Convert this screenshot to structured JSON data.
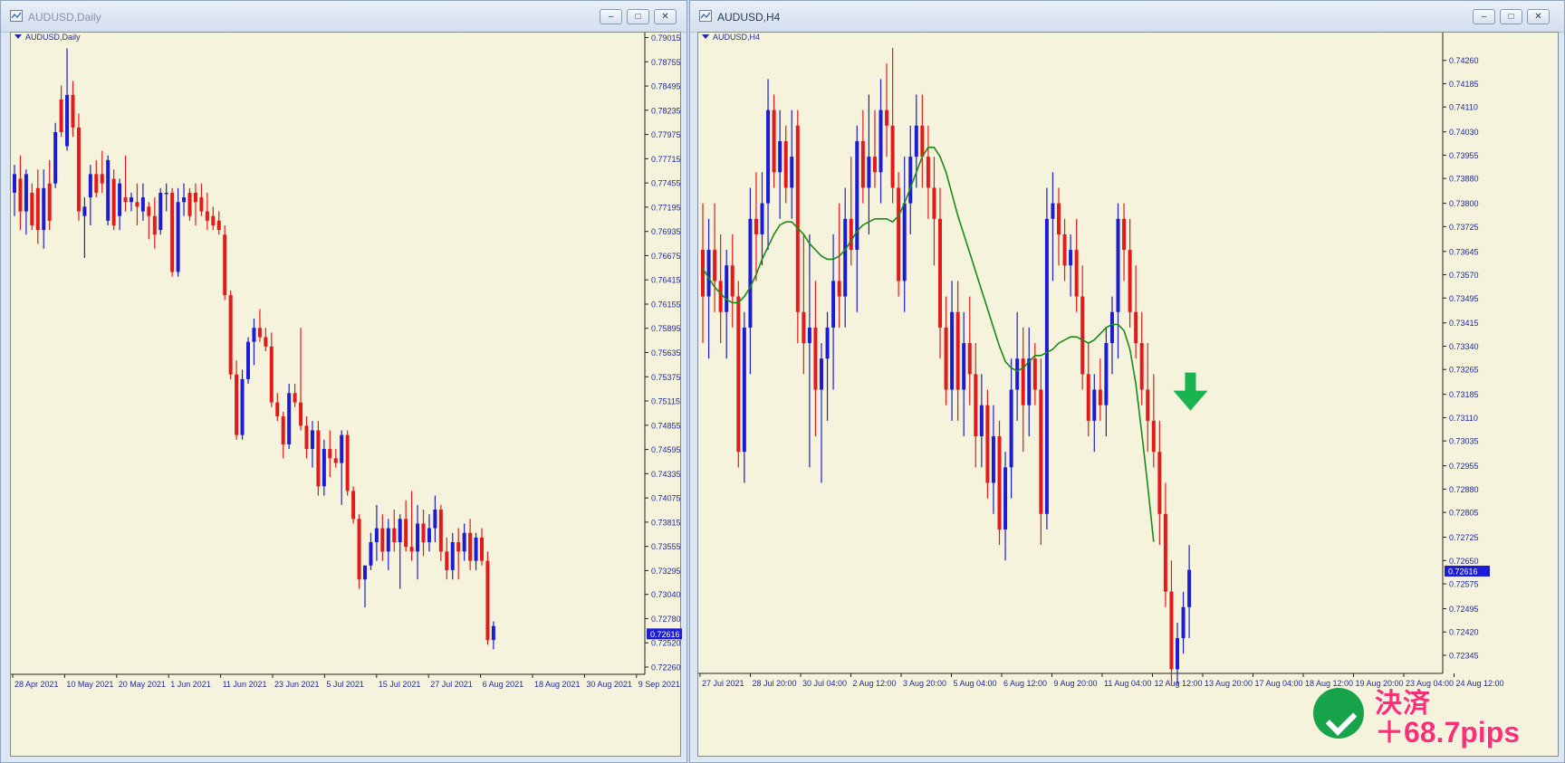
{
  "windows": {
    "left": {
      "title": "AUDUSD,Daily",
      "symbol_label": "AUDUSD,Daily"
    },
    "right": {
      "title": "AUDUSD,H4",
      "symbol_label": "AUDUSD,H4"
    }
  },
  "window_buttons": [
    "minimize",
    "restore",
    "close"
  ],
  "colors": {
    "background": "#f5f3dc",
    "bull": "#1c1cd6",
    "bear": "#e41a1a",
    "ma": "#1a8a1a",
    "price_tag": "#1c1cd6",
    "signal_arrow": "#19b44f",
    "badge": "#17a34a",
    "result_text": "#ff2f74"
  },
  "chart_data": [
    {
      "type": "candlestick",
      "title": "AUDUSD,Daily",
      "current_price": 0.72616,
      "y_ticks": [
        "0.79015",
        "0.78755",
        "0.78495",
        "0.78235",
        "0.77975",
        "0.77715",
        "0.77455",
        "0.77195",
        "0.76935",
        "0.76675",
        "0.76415",
        "0.76155",
        "0.75895",
        "0.75635",
        "0.75375",
        "0.75115",
        "0.74855",
        "0.74595",
        "0.74335",
        "0.74075",
        "0.73815",
        "0.73555",
        "0.73295",
        "0.73040",
        "0.72780",
        "0.72520",
        "0.72260"
      ],
      "x_ticks": [
        "28 Apr 2021",
        "10 May 2021",
        "20 May 2021",
        "1 Jun 2021",
        "11 Jun 2021",
        "23 Jun 2021",
        "5 Jul 2021",
        "15 Jul 2021",
        "27 Jul 2021",
        "6 Aug 2021",
        "18 Aug 2021",
        "30 Aug 2021",
        "9 Sep 2021"
      ],
      "ylim": [
        0.7226,
        0.7902
      ],
      "candles": [
        [
          0.7735,
          0.7765,
          0.771,
          0.7755
        ],
        [
          0.775,
          0.7775,
          0.7695,
          0.7715
        ],
        [
          0.7715,
          0.776,
          0.769,
          0.7755
        ],
        [
          0.7735,
          0.7745,
          0.7695,
          0.77
        ],
        [
          0.774,
          0.776,
          0.768,
          0.7695
        ],
        [
          0.7695,
          0.776,
          0.7675,
          0.774
        ],
        [
          0.7745,
          0.777,
          0.7695,
          0.7705
        ],
        [
          0.7745,
          0.781,
          0.774,
          0.78
        ],
        [
          0.7835,
          0.785,
          0.7795,
          0.78
        ],
        [
          0.7785,
          0.789,
          0.778,
          0.784
        ],
        [
          0.784,
          0.7855,
          0.7795,
          0.7805
        ],
        [
          0.7805,
          0.782,
          0.7705,
          0.7715
        ],
        [
          0.771,
          0.773,
          0.7665,
          0.772
        ],
        [
          0.773,
          0.7765,
          0.77,
          0.7755
        ],
        [
          0.7755,
          0.777,
          0.773,
          0.7735
        ],
        [
          0.7755,
          0.778,
          0.7735,
          0.7745
        ],
        [
          0.7705,
          0.7775,
          0.77,
          0.777
        ],
        [
          0.775,
          0.776,
          0.7695,
          0.77
        ],
        [
          0.771,
          0.775,
          0.7695,
          0.7745
        ],
        [
          0.773,
          0.7775,
          0.7715,
          0.7725
        ],
        [
          0.7725,
          0.7735,
          0.7715,
          0.773
        ],
        [
          0.7725,
          0.7745,
          0.77,
          0.772
        ],
        [
          0.7715,
          0.7745,
          0.7705,
          0.773
        ],
        [
          0.772,
          0.7725,
          0.7685,
          0.771
        ],
        [
          0.771,
          0.773,
          0.7675,
          0.769
        ],
        [
          0.7695,
          0.774,
          0.769,
          0.7735
        ],
        [
          0.7735,
          0.7745,
          0.7715,
          0.7735
        ],
        [
          0.7735,
          0.774,
          0.7645,
          0.765
        ],
        [
          0.765,
          0.774,
          0.7645,
          0.7725
        ],
        [
          0.7725,
          0.7745,
          0.771,
          0.773
        ],
        [
          0.7735,
          0.774,
          0.7705,
          0.771
        ],
        [
          0.7735,
          0.7745,
          0.77,
          0.7725
        ],
        [
          0.773,
          0.7745,
          0.771,
          0.7715
        ],
        [
          0.7715,
          0.7735,
          0.7695,
          0.7705
        ],
        [
          0.771,
          0.772,
          0.7695,
          0.77
        ],
        [
          0.7705,
          0.7715,
          0.769,
          0.7695
        ],
        [
          0.769,
          0.77,
          0.762,
          0.7625
        ],
        [
          0.7625,
          0.763,
          0.7535,
          0.754
        ],
        [
          0.754,
          0.7555,
          0.747,
          0.7475
        ],
        [
          0.7475,
          0.7545,
          0.747,
          0.7535
        ],
        [
          0.7535,
          0.758,
          0.753,
          0.7575
        ],
        [
          0.7575,
          0.76,
          0.755,
          0.759
        ],
        [
          0.759,
          0.761,
          0.7575,
          0.758
        ],
        [
          0.758,
          0.759,
          0.7565,
          0.757
        ],
        [
          0.757,
          0.7585,
          0.7505,
          0.751
        ],
        [
          0.751,
          0.752,
          0.749,
          0.7495
        ],
        [
          0.7495,
          0.75,
          0.745,
          0.7465
        ],
        [
          0.7465,
          0.753,
          0.746,
          0.752
        ],
        [
          0.752,
          0.753,
          0.7505,
          0.751
        ],
        [
          0.751,
          0.759,
          0.748,
          0.7485
        ],
        [
          0.7485,
          0.7495,
          0.745,
          0.746
        ],
        [
          0.746,
          0.749,
          0.744,
          0.748
        ],
        [
          0.748,
          0.749,
          0.741,
          0.742
        ],
        [
          0.742,
          0.747,
          0.741,
          0.746
        ],
        [
          0.746,
          0.748,
          0.743,
          0.745
        ],
        [
          0.745,
          0.746,
          0.744,
          0.7445
        ],
        [
          0.7445,
          0.748,
          0.74,
          0.7475
        ],
        [
          0.7475,
          0.748,
          0.741,
          0.7415
        ],
        [
          0.7415,
          0.742,
          0.738,
          0.7385
        ],
        [
          0.7385,
          0.739,
          0.731,
          0.732
        ],
        [
          0.732,
          0.7335,
          0.729,
          0.7335
        ],
        [
          0.7335,
          0.737,
          0.733,
          0.736
        ],
        [
          0.736,
          0.74,
          0.734,
          0.7375
        ],
        [
          0.7375,
          0.739,
          0.734,
          0.735
        ],
        [
          0.735,
          0.7385,
          0.733,
          0.7375
        ],
        [
          0.7375,
          0.7395,
          0.735,
          0.736
        ],
        [
          0.736,
          0.739,
          0.731,
          0.7385
        ],
        [
          0.7385,
          0.7405,
          0.735,
          0.7355
        ],
        [
          0.7355,
          0.7415,
          0.734,
          0.735
        ],
        [
          0.735,
          0.74,
          0.732,
          0.738
        ],
        [
          0.738,
          0.7395,
          0.7345,
          0.736
        ],
        [
          0.736,
          0.739,
          0.735,
          0.7375
        ],
        [
          0.7375,
          0.741,
          0.736,
          0.7395
        ],
        [
          0.7395,
          0.74,
          0.734,
          0.735
        ],
        [
          0.735,
          0.7365,
          0.732,
          0.733
        ],
        [
          0.733,
          0.737,
          0.732,
          0.736
        ],
        [
          0.736,
          0.7375,
          0.732,
          0.735
        ],
        [
          0.735,
          0.738,
          0.734,
          0.737
        ],
        [
          0.737,
          0.7385,
          0.733,
          0.734
        ],
        [
          0.734,
          0.737,
          0.733,
          0.7365
        ],
        [
          0.7365,
          0.7375,
          0.7335,
          0.734
        ],
        [
          0.734,
          0.735,
          0.725,
          0.7255
        ],
        [
          0.7255,
          0.7275,
          0.7245,
          0.727
        ]
      ]
    },
    {
      "type": "candlestick",
      "title": "AUDUSD,H4",
      "current_price": 0.72616,
      "y_ticks": [
        "0.74260",
        "0.74185",
        "0.74110",
        "0.74030",
        "0.73955",
        "0.73880",
        "0.73800",
        "0.73725",
        "0.73645",
        "0.73570",
        "0.73495",
        "0.73415",
        "0.73340",
        "0.73265",
        "0.73185",
        "0.73110",
        "0.73035",
        "0.72955",
        "0.72880",
        "0.72805",
        "0.72725",
        "0.72650",
        "0.72575",
        "0.72495",
        "0.72420",
        "0.72345"
      ],
      "x_ticks": [
        "27 Jul 2021",
        "28 Jul 20:00",
        "30 Jul 04:00",
        "2 Aug 12:00",
        "3 Aug 20:00",
        "5 Aug 04:00",
        "6 Aug 12:00",
        "9 Aug 20:00",
        "11 Aug 04:00",
        "12 Aug 12:00",
        "13 Aug 20:00",
        "17 Aug 04:00",
        "18 Aug 12:00",
        "19 Aug 20:00",
        "23 Aug 04:00",
        "24 Aug 12:00"
      ],
      "ylim": [
        0.7231,
        0.743
      ],
      "ma_label": "",
      "candles": [
        [
          0.7365,
          0.738,
          0.7335,
          0.735
        ],
        [
          0.735,
          0.7375,
          0.733,
          0.7365
        ],
        [
          0.7365,
          0.738,
          0.7345,
          0.7355
        ],
        [
          0.7355,
          0.737,
          0.7335,
          0.7345
        ],
        [
          0.7345,
          0.7365,
          0.733,
          0.736
        ],
        [
          0.736,
          0.737,
          0.734,
          0.735
        ],
        [
          0.735,
          0.7355,
          0.7295,
          0.73
        ],
        [
          0.73,
          0.7345,
          0.729,
          0.734
        ],
        [
          0.734,
          0.7385,
          0.7325,
          0.7375
        ],
        [
          0.7375,
          0.739,
          0.7355,
          0.737
        ],
        [
          0.737,
          0.739,
          0.736,
          0.738
        ],
        [
          0.738,
          0.742,
          0.7365,
          0.741
        ],
        [
          0.741,
          0.7415,
          0.7385,
          0.739
        ],
        [
          0.739,
          0.741,
          0.7375,
          0.74
        ],
        [
          0.74,
          0.7405,
          0.738,
          0.7385
        ],
        [
          0.7385,
          0.741,
          0.7375,
          0.7395
        ],
        [
          0.7405,
          0.741,
          0.7335,
          0.7345
        ],
        [
          0.7345,
          0.737,
          0.7325,
          0.7335
        ],
        [
          0.7335,
          0.737,
          0.7295,
          0.734
        ],
        [
          0.734,
          0.7355,
          0.7305,
          0.732
        ],
        [
          0.732,
          0.7335,
          0.729,
          0.733
        ],
        [
          0.733,
          0.7345,
          0.731,
          0.734
        ],
        [
          0.734,
          0.737,
          0.732,
          0.7355
        ],
        [
          0.7355,
          0.738,
          0.734,
          0.735
        ],
        [
          0.735,
          0.7385,
          0.734,
          0.7375
        ],
        [
          0.7375,
          0.7395,
          0.736,
          0.7365
        ],
        [
          0.7365,
          0.7405,
          0.7345,
          0.74
        ],
        [
          0.74,
          0.741,
          0.738,
          0.7385
        ],
        [
          0.7385,
          0.7415,
          0.737,
          0.7395
        ],
        [
          0.7395,
          0.741,
          0.7385,
          0.739
        ],
        [
          0.739,
          0.742,
          0.738,
          0.741
        ],
        [
          0.741,
          0.7425,
          0.7395,
          0.7405
        ],
        [
          0.7405,
          0.743,
          0.738,
          0.7385
        ],
        [
          0.7385,
          0.739,
          0.735,
          0.7355
        ],
        [
          0.7355,
          0.7395,
          0.7345,
          0.738
        ],
        [
          0.738,
          0.7405,
          0.737,
          0.7395
        ],
        [
          0.7395,
          0.7415,
          0.7385,
          0.7405
        ],
        [
          0.7405,
          0.7415,
          0.7385,
          0.7395
        ],
        [
          0.7395,
          0.7405,
          0.7375,
          0.7385
        ],
        [
          0.7385,
          0.7395,
          0.736,
          0.7375
        ],
        [
          0.7375,
          0.7385,
          0.733,
          0.734
        ],
        [
          0.734,
          0.735,
          0.7315,
          0.732
        ],
        [
          0.732,
          0.7355,
          0.731,
          0.7345
        ],
        [
          0.7345,
          0.7355,
          0.731,
          0.732
        ],
        [
          0.732,
          0.7345,
          0.7305,
          0.7335
        ],
        [
          0.7335,
          0.735,
          0.7315,
          0.7325
        ],
        [
          0.7325,
          0.7335,
          0.7295,
          0.7305
        ],
        [
          0.7305,
          0.7325,
          0.7295,
          0.7315
        ],
        [
          0.7315,
          0.732,
          0.7285,
          0.729
        ],
        [
          0.729,
          0.7315,
          0.728,
          0.7305
        ],
        [
          0.7305,
          0.731,
          0.727,
          0.7275
        ],
        [
          0.7275,
          0.73,
          0.7265,
          0.7295
        ],
        [
          0.7295,
          0.733,
          0.7285,
          0.732
        ],
        [
          0.732,
          0.7345,
          0.731,
          0.733
        ],
        [
          0.733,
          0.734,
          0.73,
          0.7315
        ],
        [
          0.7315,
          0.734,
          0.7305,
          0.733
        ],
        [
          0.733,
          0.7335,
          0.7315,
          0.732
        ],
        [
          0.732,
          0.733,
          0.727,
          0.728
        ],
        [
          0.728,
          0.7385,
          0.7275,
          0.7375
        ],
        [
          0.7375,
          0.739,
          0.7355,
          0.738
        ],
        [
          0.738,
          0.7385,
          0.736,
          0.737
        ],
        [
          0.737,
          0.7375,
          0.7355,
          0.736
        ],
        [
          0.736,
          0.737,
          0.735,
          0.7365
        ],
        [
          0.7365,
          0.7375,
          0.7345,
          0.735
        ],
        [
          0.735,
          0.736,
          0.732,
          0.7325
        ],
        [
          0.7325,
          0.7335,
          0.7305,
          0.731
        ],
        [
          0.731,
          0.7325,
          0.73,
          0.732
        ],
        [
          0.732,
          0.733,
          0.731,
          0.7315
        ],
        [
          0.7315,
          0.734,
          0.7305,
          0.7335
        ],
        [
          0.7335,
          0.735,
          0.7325,
          0.7345
        ],
        [
          0.7345,
          0.738,
          0.733,
          0.7375
        ],
        [
          0.7375,
          0.738,
          0.7355,
          0.7365
        ],
        [
          0.7365,
          0.7375,
          0.734,
          0.7345
        ],
        [
          0.7345,
          0.736,
          0.733,
          0.7335
        ],
        [
          0.7335,
          0.7345,
          0.7315,
          0.732
        ],
        [
          0.732,
          0.7335,
          0.73,
          0.731
        ],
        [
          0.731,
          0.7325,
          0.7295,
          0.73
        ],
        [
          0.73,
          0.731,
          0.727,
          0.728
        ],
        [
          0.728,
          0.729,
          0.725,
          0.7255
        ],
        [
          0.7255,
          0.7265,
          0.7225,
          0.723
        ],
        [
          0.723,
          0.7245,
          0.7225,
          0.724
        ],
        [
          0.724,
          0.7255,
          0.7235,
          0.725
        ],
        [
          0.725,
          0.727,
          0.724,
          0.7262
        ]
      ],
      "ma": [
        0.7359,
        0.7356,
        0.7353,
        0.7351,
        0.7349,
        0.7348,
        0.7348,
        0.735,
        0.7353,
        0.7357,
        0.7362,
        0.7366,
        0.737,
        0.7373,
        0.7374,
        0.7374,
        0.7372,
        0.737,
        0.7367,
        0.7365,
        0.7363,
        0.7362,
        0.7362,
        0.7363,
        0.7365,
        0.7368,
        0.7371,
        0.7373,
        0.7374,
        0.7375,
        0.7375,
        0.7375,
        0.7374,
        0.7376,
        0.738,
        0.7385,
        0.739,
        0.7395,
        0.7398,
        0.7398,
        0.7395,
        0.739,
        0.7383,
        0.7376,
        0.737,
        0.7364,
        0.7358,
        0.7352,
        0.7346,
        0.734,
        0.7334,
        0.7329,
        0.7327,
        0.7326,
        0.7327,
        0.7329,
        0.7331,
        0.7331,
        0.7332,
        0.7333,
        0.7335,
        0.7336,
        0.7337,
        0.7337,
        0.7336,
        0.7335,
        0.7336,
        0.7338,
        0.734,
        0.7341,
        0.7341,
        0.7339,
        0.7333,
        0.7322,
        0.7306,
        0.7289,
        0.7271
      ]
    }
  ],
  "signal": {
    "direction": "down",
    "icon": "down-arrow-icon"
  },
  "result": {
    "label": "決済",
    "value": "＋68.7pips",
    "icon": "check-icon"
  }
}
